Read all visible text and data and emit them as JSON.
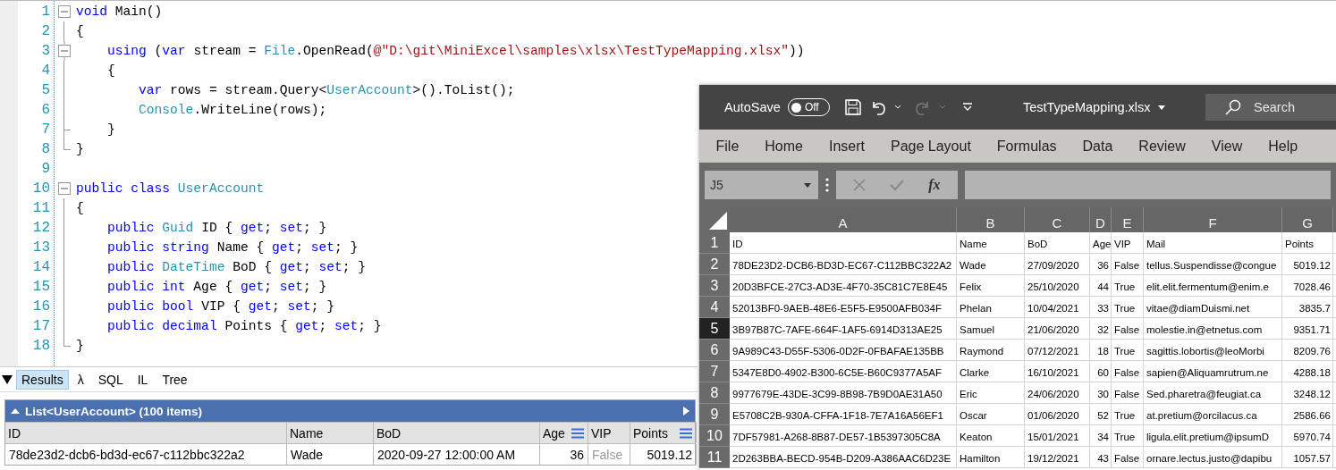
{
  "editor": {
    "lines": [
      {
        "number": "1",
        "collapsible": true,
        "in_block": false,
        "block_end": false,
        "tokens": [
          {
            "kind": "kw",
            "text": "void"
          },
          {
            "kind": "plain",
            "text": " Main()"
          }
        ]
      },
      {
        "number": "2",
        "collapsible": false,
        "in_block": true,
        "block_end": false,
        "tokens": [
          {
            "kind": "plain",
            "text": "{"
          }
        ]
      },
      {
        "number": "3",
        "collapsible": true,
        "in_block": true,
        "block_end": false,
        "tokens": [
          {
            "kind": "kw",
            "text": "    using"
          },
          {
            "kind": "plain",
            "text": " ("
          },
          {
            "kind": "kw",
            "text": "var"
          },
          {
            "kind": "plain",
            "text": " stream = "
          },
          {
            "kind": "type",
            "text": "File"
          },
          {
            "kind": "plain",
            "text": ".OpenRead("
          },
          {
            "kind": "str",
            "text": "@\"D:\\git\\MiniExcel\\samples\\xlsx\\TestTypeMapping.xlsx\""
          },
          {
            "kind": "plain",
            "text": "))"
          }
        ]
      },
      {
        "number": "4",
        "collapsible": false,
        "in_block": true,
        "block_end": false,
        "tokens": [
          {
            "kind": "plain",
            "text": "    {"
          }
        ]
      },
      {
        "number": "5",
        "collapsible": false,
        "in_block": true,
        "block_end": false,
        "tokens": [
          {
            "kind": "kw",
            "text": "        var"
          },
          {
            "kind": "plain",
            "text": " rows = stream.Query<"
          },
          {
            "kind": "type",
            "text": "UserAccount"
          },
          {
            "kind": "plain",
            "text": ">().ToList();"
          }
        ]
      },
      {
        "number": "6",
        "collapsible": false,
        "in_block": true,
        "block_end": false,
        "tokens": [
          {
            "kind": "type",
            "text": "        Console"
          },
          {
            "kind": "plain",
            "text": ".WriteLine(rows);"
          }
        ]
      },
      {
        "number": "7",
        "collapsible": false,
        "in_block": true,
        "block_end": true,
        "tokens": [
          {
            "kind": "plain",
            "text": "    }"
          }
        ]
      },
      {
        "number": "8",
        "collapsible": false,
        "in_block": false,
        "block_end": true,
        "tokens": [
          {
            "kind": "plain",
            "text": "}"
          }
        ]
      },
      {
        "number": "9",
        "collapsible": false,
        "in_block": false,
        "block_end": false
      },
      {
        "number": "10",
        "collapsible": true,
        "in_block": false,
        "block_end": false,
        "tokens": [
          {
            "kind": "kw",
            "text": "public"
          },
          {
            "kind": "kw",
            "text": " class"
          },
          {
            "kind": "type",
            "text": " UserAccount"
          }
        ]
      },
      {
        "number": "11",
        "collapsible": false,
        "in_block": true,
        "block_end": false,
        "tokens": [
          {
            "kind": "plain",
            "text": "{"
          }
        ]
      },
      {
        "number": "12",
        "collapsible": false,
        "in_block": true,
        "block_end": false,
        "tokens": [
          {
            "kind": "kw",
            "text": "    public"
          },
          {
            "kind": "type",
            "text": " Guid"
          },
          {
            "kind": "plain",
            "text": " ID { "
          },
          {
            "kind": "kw",
            "text": "get"
          },
          {
            "kind": "plain",
            "text": "; "
          },
          {
            "kind": "kw",
            "text": "set"
          },
          {
            "kind": "plain",
            "text": "; }"
          }
        ]
      },
      {
        "number": "13",
        "collapsible": false,
        "in_block": true,
        "block_end": false,
        "tokens": [
          {
            "kind": "kw",
            "text": "    public"
          },
          {
            "kind": "kw",
            "text": " string"
          },
          {
            "kind": "plain",
            "text": " Name { "
          },
          {
            "kind": "kw",
            "text": "get"
          },
          {
            "kind": "plain",
            "text": "; "
          },
          {
            "kind": "kw",
            "text": "set"
          },
          {
            "kind": "plain",
            "text": "; }"
          }
        ]
      },
      {
        "number": "14",
        "collapsible": false,
        "in_block": true,
        "block_end": false,
        "tokens": [
          {
            "kind": "kw",
            "text": "    public"
          },
          {
            "kind": "type",
            "text": " DateTime"
          },
          {
            "kind": "plain",
            "text": " BoD { "
          },
          {
            "kind": "kw",
            "text": "get"
          },
          {
            "kind": "plain",
            "text": "; "
          },
          {
            "kind": "kw",
            "text": "set"
          },
          {
            "kind": "plain",
            "text": "; }"
          }
        ]
      },
      {
        "number": "15",
        "collapsible": false,
        "in_block": true,
        "block_end": false,
        "tokens": [
          {
            "kind": "kw",
            "text": "    public"
          },
          {
            "kind": "kw",
            "text": " int"
          },
          {
            "kind": "plain",
            "text": " Age { "
          },
          {
            "kind": "kw",
            "text": "get"
          },
          {
            "kind": "plain",
            "text": "; "
          },
          {
            "kind": "kw",
            "text": "set"
          },
          {
            "kind": "plain",
            "text": "; }"
          }
        ]
      },
      {
        "number": "16",
        "collapsible": false,
        "in_block": true,
        "block_end": false,
        "tokens": [
          {
            "kind": "kw",
            "text": "    public"
          },
          {
            "kind": "kw",
            "text": " bool"
          },
          {
            "kind": "plain",
            "text": " VIP { "
          },
          {
            "kind": "kw",
            "text": "get"
          },
          {
            "kind": "plain",
            "text": "; "
          },
          {
            "kind": "kw",
            "text": "set"
          },
          {
            "kind": "plain",
            "text": "; }"
          }
        ]
      },
      {
        "number": "17",
        "collapsible": false,
        "in_block": true,
        "block_end": false,
        "tokens": [
          {
            "kind": "kw",
            "text": "    public"
          },
          {
            "kind": "kw",
            "text": " decimal"
          },
          {
            "kind": "plain",
            "text": " Points { "
          },
          {
            "kind": "kw",
            "text": "get"
          },
          {
            "kind": "plain",
            "text": "; "
          },
          {
            "kind": "kw",
            "text": "set"
          },
          {
            "kind": "plain",
            "text": "; }"
          }
        ]
      },
      {
        "number": "18",
        "collapsible": false,
        "in_block": false,
        "block_end": true,
        "tokens": [
          {
            "kind": "plain",
            "text": "}"
          }
        ]
      }
    ]
  },
  "results": {
    "tabs": [
      {
        "label": "Results",
        "selected": true
      },
      {
        "label": "λ",
        "selected": false
      },
      {
        "label": "SQL",
        "selected": false
      },
      {
        "label": "IL",
        "selected": false
      },
      {
        "label": "Tree",
        "selected": false
      }
    ],
    "title": "List<UserAccount> (100 items)",
    "columns": [
      {
        "label": "ID",
        "kind": "text",
        "menu": false
      },
      {
        "label": "Name",
        "kind": "text",
        "menu": false
      },
      {
        "label": "BoD",
        "kind": "text",
        "menu": false
      },
      {
        "label": "Age",
        "kind": "number",
        "menu": true
      },
      {
        "label": "VIP",
        "kind": "bool",
        "menu": false
      },
      {
        "label": "Points",
        "kind": "number",
        "menu": true
      }
    ],
    "rows": [
      [
        "78de23d2-dcb6-bd3d-ec67-c112bbc322a2",
        "Wade",
        "2020-09-27 12:00:00 AM",
        "36",
        "False",
        "5019.12"
      ]
    ]
  },
  "excel": {
    "autosave": {
      "label": "AutoSave",
      "toggle": "Off",
      "on": false
    },
    "redo_disabled": true,
    "file_name": "TestTypeMapping.xlsx",
    "search": "Search",
    "ribbon": [
      "File",
      "Home",
      "Insert",
      "Page Layout",
      "Formulas",
      "Data",
      "Review",
      "View",
      "Help"
    ],
    "name_box": "J5",
    "function_button": "fx",
    "columns": [
      "A",
      "B",
      "C",
      "D",
      "E",
      "F",
      "G"
    ],
    "rows": [
      {
        "number": "1",
        "selected": false,
        "cells": [
          "ID",
          "Name",
          "BoD",
          "Age",
          "VIP",
          "Mail",
          "Points"
        ]
      },
      {
        "number": "2",
        "selected": false,
        "cells": [
          "78DE23D2-DCB6-BD3D-EC67-C112BBC322A2",
          "Wade",
          "27/09/2020",
          "36",
          "False",
          "tellus.Suspendisse@congue",
          "5019.12"
        ]
      },
      {
        "number": "3",
        "selected": false,
        "cells": [
          "20D3BFCE-27C3-AD3E-4F70-35C81C7E8E45",
          "Felix",
          "25/10/2020",
          "44",
          "True",
          "elit.elit.fermentum@enim.e",
          "7028.46"
        ]
      },
      {
        "number": "4",
        "selected": false,
        "cells": [
          "52013BF0-9AEB-48E6-E5F5-E9500AFB034F",
          "Phelan",
          "10/04/2021",
          "33",
          "True",
          "vitae@diamDuismi.net",
          "3835.7"
        ]
      },
      {
        "number": "5",
        "selected": true,
        "cells": [
          "3B97B87C-7AFE-664F-1AF5-6914D313AE25",
          "Samuel",
          "21/06/2020",
          "32",
          "False",
          "molestie.in@etnetus.com",
          "9351.71"
        ]
      },
      {
        "number": "6",
        "selected": false,
        "cells": [
          "9A989C43-D55F-5306-0D2F-0FBAFAE135BB",
          "Raymond",
          "07/12/2021",
          "18",
          "True",
          "sagittis.lobortis@leoMorbi",
          "8209.76"
        ]
      },
      {
        "number": "7",
        "selected": false,
        "cells": [
          "5347E8D0-4902-B300-6C5E-B60C9377A5AF",
          "Clarke",
          "16/10/2021",
          "60",
          "False",
          "sapien@Aliquamrutrum.ne",
          "4288.18"
        ]
      },
      {
        "number": "8",
        "selected": false,
        "cells": [
          "9977679E-43DE-3C99-8B98-7B9D0AE31A50",
          "Eric",
          "24/06/2020",
          "30",
          "False",
          "Sed.pharetra@feugiat.ca",
          "3248.12"
        ]
      },
      {
        "number": "9",
        "selected": false,
        "cells": [
          "E5708C2B-930A-CFFA-1F18-7E7A16A56EF1",
          "Oscar",
          "01/06/2020",
          "52",
          "True",
          "at.pretium@orcilacus.ca",
          "2586.66"
        ]
      },
      {
        "number": "10",
        "selected": false,
        "cells": [
          "7DF57981-A268-8B87-DE57-1B5397305C8A",
          "Keaton",
          "15/01/2021",
          "34",
          "True",
          "ligula.elit.pretium@ipsumD",
          "5970.74"
        ]
      },
      {
        "number": "11",
        "selected": false,
        "cells": [
          "2D263BBA-BECD-954B-D209-A386AAC6D23E",
          "Hamilton",
          "19/12/2021",
          "43",
          "False",
          "ornare.lectus.justo@dapibu",
          "1057.57"
        ]
      }
    ]
  }
}
